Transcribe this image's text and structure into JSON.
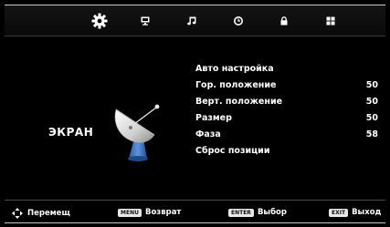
{
  "tabs": [
    {
      "icon": "gear-icon",
      "active": true
    },
    {
      "icon": "monitor-icon",
      "active": false
    },
    {
      "icon": "music-note-icon",
      "active": false
    },
    {
      "icon": "clock-icon",
      "active": false
    },
    {
      "icon": "lock-icon",
      "active": false
    },
    {
      "icon": "grid-icon",
      "active": false
    }
  ],
  "section": {
    "title": "ЭКРАН",
    "icon": "satellite-dish-icon"
  },
  "menu": {
    "items": [
      {
        "label": "Авто настройка",
        "value": ""
      },
      {
        "label": "Гор. положение",
        "value": "50"
      },
      {
        "label": "Верт. положение",
        "value": "50"
      },
      {
        "label": "Размер",
        "value": "50"
      },
      {
        "label": "Фаза",
        "value": "58"
      },
      {
        "label": "Сброс позиции",
        "value": ""
      }
    ]
  },
  "footer": {
    "move_label": "Перемещ",
    "menu_key": "MENU",
    "back_label": "Возврат",
    "enter_key": "ENTER",
    "select_label": "Выбор",
    "exit_key": "EXIT",
    "exit_label": "Выход"
  },
  "colors": {
    "background": "#000000",
    "text": "#ffffff",
    "keycap": "#e8e8e8",
    "dish": "#3f78c8"
  }
}
